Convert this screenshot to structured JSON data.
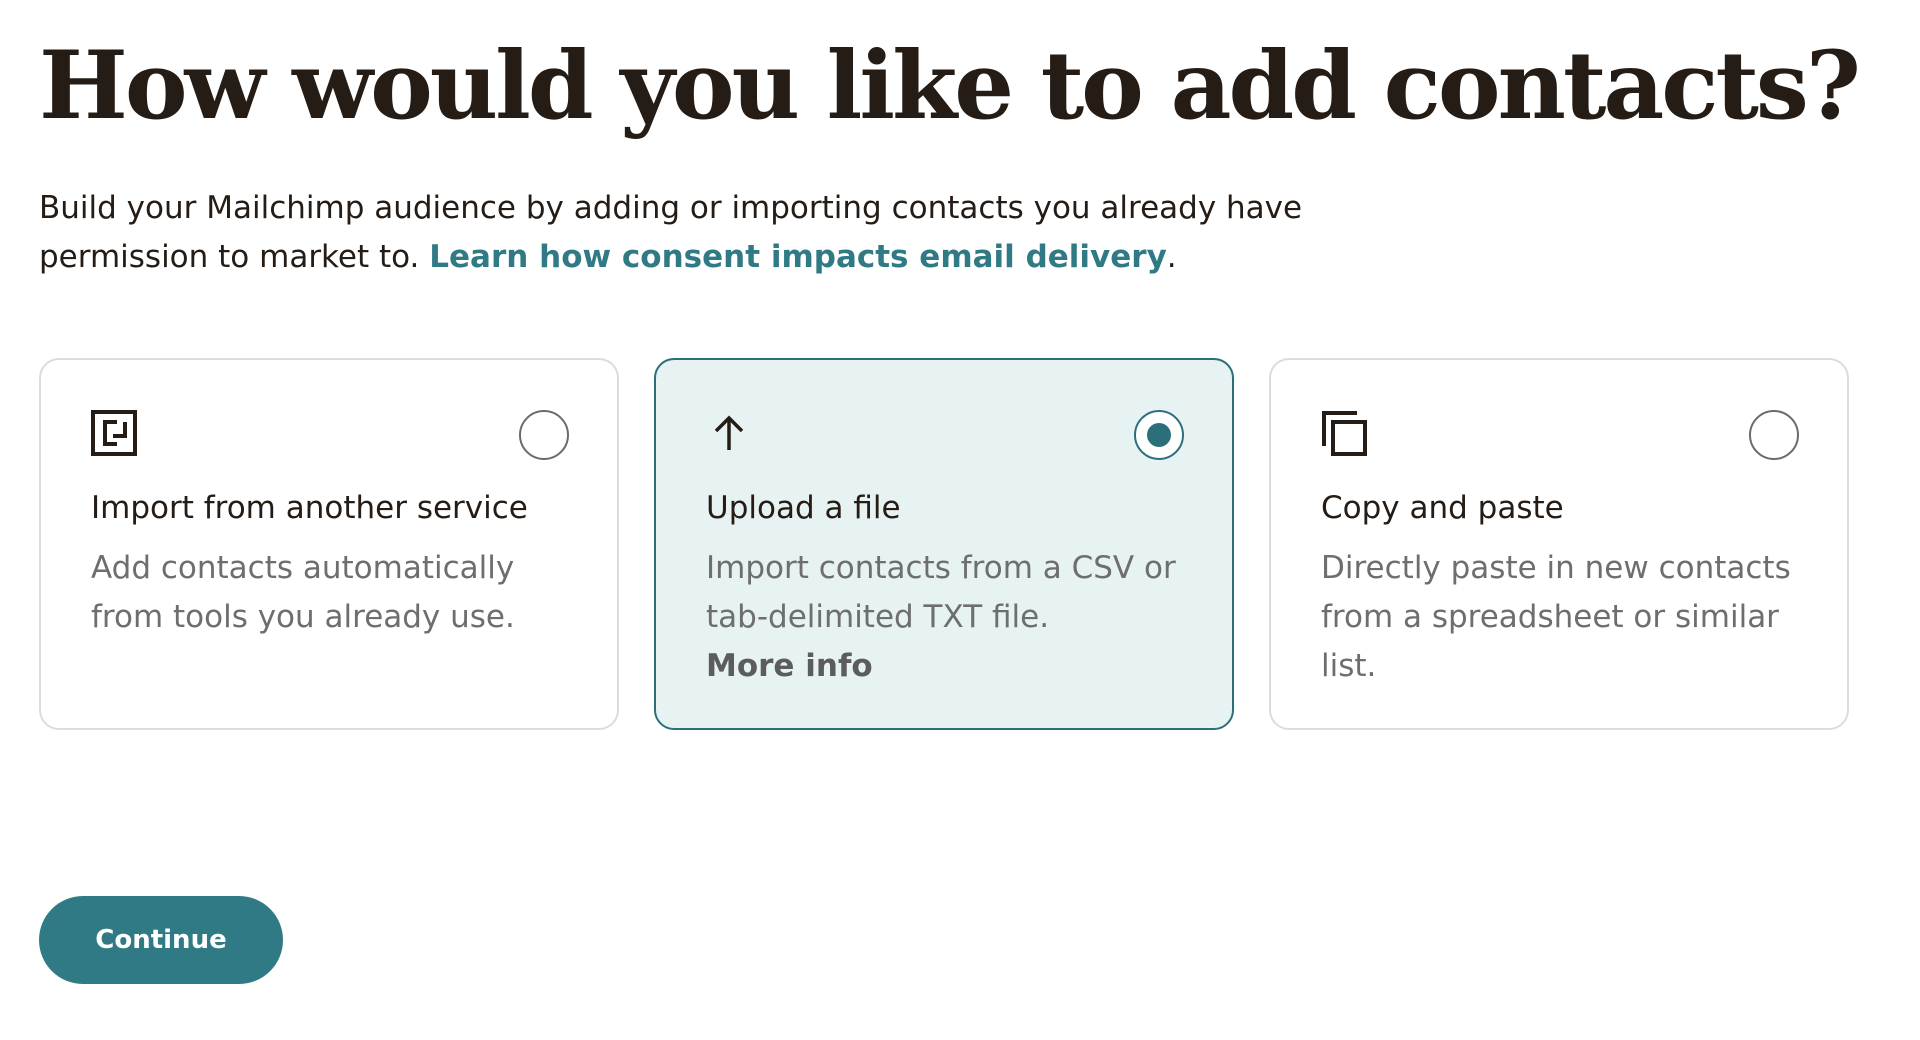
{
  "heading": "How would you like to add contacts?",
  "intro": {
    "text": "Build your Mailchimp audience by adding or importing contacts you already have permission to market to.",
    "link": "Learn how consent impacts email delivery",
    "trailing": "."
  },
  "options": [
    {
      "icon": "import-icon",
      "title": "Import from another service",
      "description": "Add contacts automatically from tools you already use.",
      "selected": false
    },
    {
      "icon": "upload-arrow-icon",
      "title": "Upload a file",
      "description": "Import contacts from a CSV or tab-delimited TXT file.",
      "more": "More info",
      "selected": true
    },
    {
      "icon": "copy-icon",
      "title": "Copy and paste",
      "description": "Directly paste in new contacts from a spreadsheet or similar list.",
      "selected": false
    }
  ],
  "continue_label": "Continue",
  "colors": {
    "accent": "#2f7a84",
    "selected_bg": "#e7f2f2",
    "selected_border": "#2c6f7a",
    "text": "#241c15",
    "muted": "#6e6e6e"
  }
}
